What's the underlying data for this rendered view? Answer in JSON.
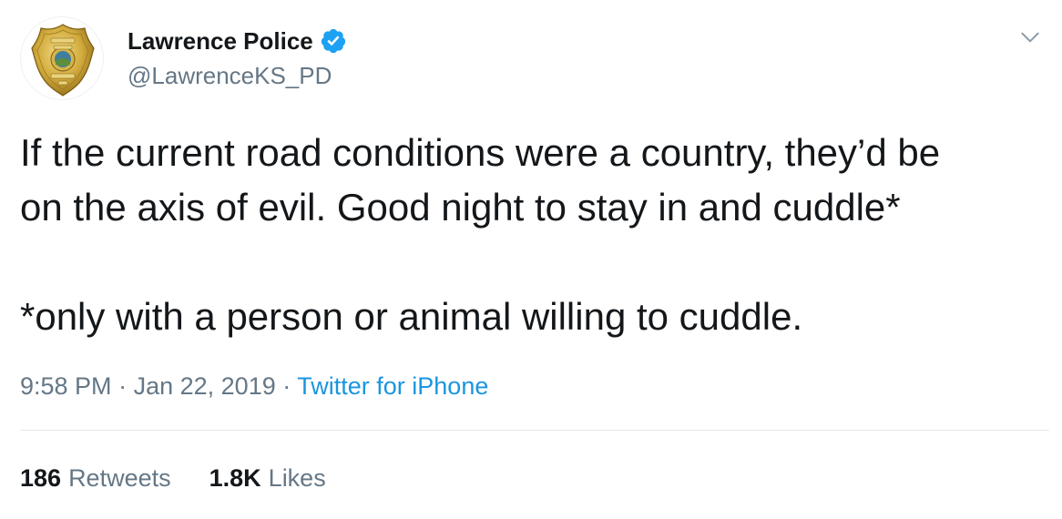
{
  "author": {
    "display_name": "Lawrence Police",
    "handle": "@LawrenceKS_PD",
    "verified": true,
    "avatar_icon": "police-badge-icon",
    "badge_text": {
      "top": "LAWRENCE",
      "middle": "POLICE",
      "bottom": "DEPARTMENT",
      "state": "KS"
    }
  },
  "tweet": {
    "text_line1": "If the current road conditions were a country, they’d be",
    "text_line2": "on the axis of evil. Good night to stay in and cuddle*",
    "text_line3": "*only with a person or animal willing to cuddle."
  },
  "meta": {
    "time": "9:58 PM",
    "separator": "·",
    "date": "Jan 22, 2019",
    "source": "Twitter for iPhone"
  },
  "stats": {
    "retweets_count": "186",
    "retweets_label": "Retweets",
    "likes_count": "1.8K",
    "likes_label": "Likes"
  },
  "colors": {
    "text_primary": "#14171a",
    "text_secondary": "#657786",
    "link": "#1b95e0",
    "verified": "#1da1f2",
    "badge_gold": "#c9a227",
    "divider": "#e1e8ed"
  },
  "icons": {
    "verified": "verified-badge-icon",
    "menu": "chevron-down-icon"
  }
}
